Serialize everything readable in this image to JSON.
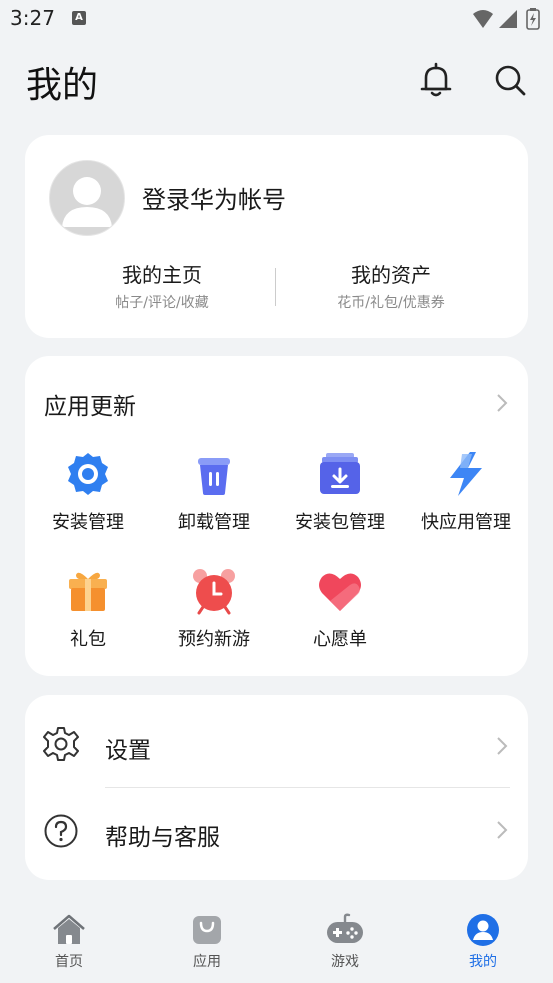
{
  "status_bar": {
    "time": "3:27",
    "notif_icon_letter": "A"
  },
  "header": {
    "title": "我的"
  },
  "profile": {
    "login_label": "登录华为帐号",
    "homepage": {
      "title": "我的主页",
      "subtitle": "帖子/评论/收藏"
    },
    "assets": {
      "title": "我的资产",
      "subtitle": "花币/礼包/优惠券"
    }
  },
  "app_update": {
    "title": "应用更新",
    "items": [
      {
        "label": "安装管理",
        "icon": "install-manage-icon"
      },
      {
        "label": "卸载管理",
        "icon": "uninstall-manage-icon"
      },
      {
        "label": "安装包管理",
        "icon": "package-manage-icon"
      },
      {
        "label": "快应用管理",
        "icon": "quick-app-icon"
      },
      {
        "label": "礼包",
        "icon": "gift-icon"
      },
      {
        "label": "预约新游",
        "icon": "alarm-clock-icon"
      },
      {
        "label": "心愿单",
        "icon": "heart-icon"
      }
    ]
  },
  "settings": {
    "items": [
      {
        "label": "设置",
        "icon": "gear-icon"
      },
      {
        "label": "帮助与客服",
        "icon": "help-icon"
      }
    ]
  },
  "tabbar": {
    "tabs": [
      {
        "label": "首页",
        "icon": "home-icon"
      },
      {
        "label": "应用",
        "icon": "apps-bag-icon"
      },
      {
        "label": "游戏",
        "icon": "gamepad-icon"
      },
      {
        "label": "我的",
        "icon": "profile-icon"
      }
    ],
    "active_index": 3
  },
  "colors": {
    "accent": "#1f6fe6",
    "background": "#f1f3f5",
    "card": "#ffffff"
  }
}
